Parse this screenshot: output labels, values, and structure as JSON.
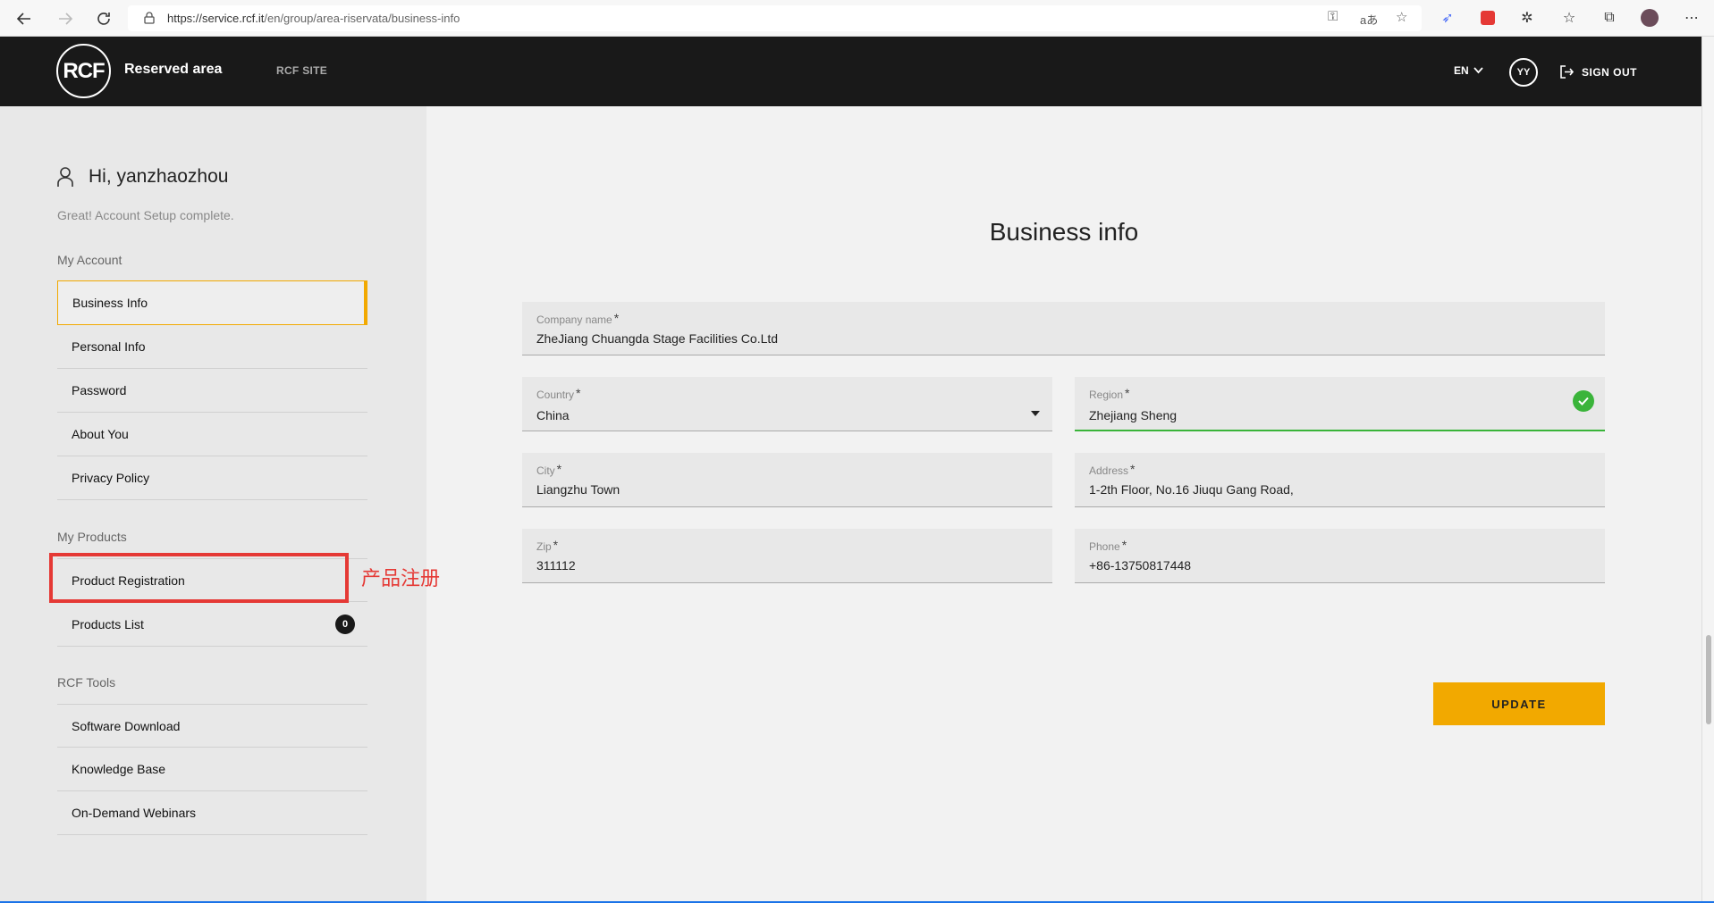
{
  "browser": {
    "url_host": "https://service.rcf.it",
    "url_path": "/en/group/area-riservata/business-info"
  },
  "header": {
    "logo_text": "RCF",
    "title": "Reserved area",
    "site_link": "RCF SITE",
    "language": "EN",
    "avatar_initials": "YY",
    "sign_out": "SIGN OUT"
  },
  "sidebar": {
    "greeting": "Hi, yanzhaozhou",
    "setup_message": "Great! Account Setup complete.",
    "sections": [
      {
        "title": "My Account",
        "items": [
          "Business Info",
          "Personal Info",
          "Password",
          "About You",
          "Privacy Policy"
        ]
      },
      {
        "title": "My Products",
        "items": [
          "Product Registration",
          "Products List"
        ]
      },
      {
        "title": "RCF Tools",
        "items": [
          "Software Download",
          "Knowledge Base",
          "On-Demand Webinars"
        ]
      }
    ],
    "products_count": "0",
    "annotation": "产品注册"
  },
  "main": {
    "title": "Business info",
    "fields": {
      "company": {
        "label": "Company name",
        "value": "ZheJiang Chuangda Stage Facilities Co.Ltd"
      },
      "country": {
        "label": "Country",
        "value": "China"
      },
      "region": {
        "label": "Region",
        "value": "Zhejiang Sheng"
      },
      "city": {
        "label": "City",
        "value": "Liangzhu Town"
      },
      "address": {
        "label": "Address",
        "value": "1-2th Floor, No.16 Jiuqu Gang Road,"
      },
      "zip": {
        "label": "Zip",
        "value": "311112"
      },
      "phone": {
        "label": "Phone",
        "value": "+86-13750817448"
      }
    },
    "required_mark": "*",
    "update_button": "UPDATE"
  },
  "colors": {
    "accent": "#f2a900",
    "header_bg": "#191919",
    "valid": "#3ab43a",
    "annotation": "#e53935"
  }
}
